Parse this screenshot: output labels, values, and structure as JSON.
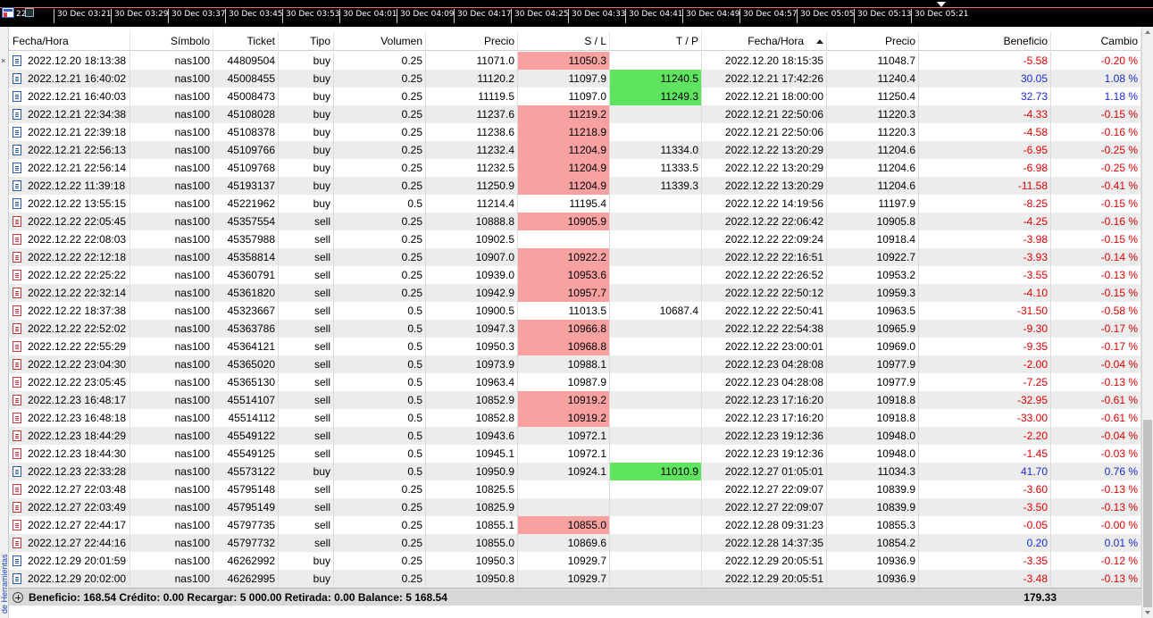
{
  "timeline": {
    "first_label": "22",
    "ticks": [
      "30 Dec 03:21",
      "30 Dec 03:29",
      "30 Dec 03:37",
      "30 Dec 03:45",
      "30 Dec 03:53",
      "30 Dec 04:01",
      "30 Dec 04:09",
      "30 Dec 04:17",
      "30 Dec 04:25",
      "30 Dec 04:33",
      "30 Dec 04:41",
      "30 Dec 04:49",
      "30 Dec 04:57",
      "30 Dec 05:05",
      "30 Dec 05:13",
      "30 Dec 05:21"
    ]
  },
  "sidebar": {
    "label": "de Herramientas",
    "close_glyph": "×"
  },
  "columns": {
    "open_time": "Fecha/Hora",
    "symbol": "Símbolo",
    "ticket": "Ticket",
    "type": "Tipo",
    "volume": "Volumen",
    "open_price": "Precio",
    "sl": "S / L",
    "tp": "T / P",
    "close_time": "Fecha/Hora",
    "close_price": "Precio",
    "profit": "Beneficio",
    "change": "Cambio"
  },
  "rows": [
    {
      "open_time": "2022.12.20 18:13:38",
      "symbol": "nas100",
      "ticket": "44809504",
      "type": "buy",
      "volume": "0.25",
      "open_price": "11071.0",
      "sl": "11050.3",
      "sl_hit": true,
      "tp": "",
      "tp_hit": false,
      "close_time": "2022.12.20 18:15:35",
      "close_price": "11048.7",
      "profit": "-5.58",
      "change": "-0.20 %"
    },
    {
      "open_time": "2022.12.21 16:40:02",
      "symbol": "nas100",
      "ticket": "45008455",
      "type": "buy",
      "volume": "0.25",
      "open_price": "11120.2",
      "sl": "11097.9",
      "sl_hit": false,
      "tp": "11240.5",
      "tp_hit": true,
      "close_time": "2022.12.21 17:42:26",
      "close_price": "11240.4",
      "profit": "30.05",
      "change": "1.08 %"
    },
    {
      "open_time": "2022.12.21 16:40:03",
      "symbol": "nas100",
      "ticket": "45008473",
      "type": "buy",
      "volume": "0.25",
      "open_price": "11119.5",
      "sl": "11097.0",
      "sl_hit": false,
      "tp": "11249.3",
      "tp_hit": true,
      "close_time": "2022.12.21 18:00:00",
      "close_price": "11250.4",
      "profit": "32.73",
      "change": "1.18 %"
    },
    {
      "open_time": "2022.12.21 22:34:38",
      "symbol": "nas100",
      "ticket": "45108028",
      "type": "buy",
      "volume": "0.25",
      "open_price": "11237.6",
      "sl": "11219.2",
      "sl_hit": true,
      "tp": "",
      "tp_hit": false,
      "close_time": "2022.12.21 22:50:06",
      "close_price": "11220.3",
      "profit": "-4.33",
      "change": "-0.15 %"
    },
    {
      "open_time": "2022.12.21 22:39:18",
      "symbol": "nas100",
      "ticket": "45108378",
      "type": "buy",
      "volume": "0.25",
      "open_price": "11238.6",
      "sl": "11218.9",
      "sl_hit": true,
      "tp": "",
      "tp_hit": false,
      "close_time": "2022.12.21 22:50:06",
      "close_price": "11220.3",
      "profit": "-4.58",
      "change": "-0.16 %"
    },
    {
      "open_time": "2022.12.21 22:56:13",
      "symbol": "nas100",
      "ticket": "45109766",
      "type": "buy",
      "volume": "0.25",
      "open_price": "11232.4",
      "sl": "11204.9",
      "sl_hit": true,
      "tp": "11334.0",
      "tp_hit": false,
      "close_time": "2022.12.22 13:20:29",
      "close_price": "11204.6",
      "profit": "-6.95",
      "change": "-0.25 %"
    },
    {
      "open_time": "2022.12.21 22:56:14",
      "symbol": "nas100",
      "ticket": "45109768",
      "type": "buy",
      "volume": "0.25",
      "open_price": "11232.5",
      "sl": "11204.9",
      "sl_hit": true,
      "tp": "11333.5",
      "tp_hit": false,
      "close_time": "2022.12.22 13:20:29",
      "close_price": "11204.6",
      "profit": "-6.98",
      "change": "-0.25 %"
    },
    {
      "open_time": "2022.12.22 11:39:18",
      "symbol": "nas100",
      "ticket": "45193137",
      "type": "buy",
      "volume": "0.25",
      "open_price": "11250.9",
      "sl": "11204.9",
      "sl_hit": true,
      "tp": "11339.3",
      "tp_hit": false,
      "close_time": "2022.12.22 13:20:29",
      "close_price": "11204.6",
      "profit": "-11.58",
      "change": "-0.41 %"
    },
    {
      "open_time": "2022.12.22 13:55:15",
      "symbol": "nas100",
      "ticket": "45221962",
      "type": "buy",
      "volume": "0.5",
      "open_price": "11214.4",
      "sl": "11195.4",
      "sl_hit": false,
      "tp": "",
      "tp_hit": false,
      "close_time": "2022.12.22 14:19:56",
      "close_price": "11197.9",
      "profit": "-8.25",
      "change": "-0.15 %"
    },
    {
      "open_time": "2022.12.22 22:05:45",
      "symbol": "nas100",
      "ticket": "45357554",
      "type": "sell",
      "volume": "0.25",
      "open_price": "10888.8",
      "sl": "10905.9",
      "sl_hit": true,
      "tp": "",
      "tp_hit": false,
      "close_time": "2022.12.22 22:06:42",
      "close_price": "10905.8",
      "profit": "-4.25",
      "change": "-0.16 %"
    },
    {
      "open_time": "2022.12.22 22:08:03",
      "symbol": "nas100",
      "ticket": "45357988",
      "type": "sell",
      "volume": "0.25",
      "open_price": "10902.5",
      "sl": "",
      "sl_hit": false,
      "tp": "",
      "tp_hit": false,
      "close_time": "2022.12.22 22:09:24",
      "close_price": "10918.4",
      "profit": "-3.98",
      "change": "-0.15 %"
    },
    {
      "open_time": "2022.12.22 22:12:18",
      "symbol": "nas100",
      "ticket": "45358814",
      "type": "sell",
      "volume": "0.25",
      "open_price": "10907.0",
      "sl": "10922.2",
      "sl_hit": true,
      "tp": "",
      "tp_hit": false,
      "close_time": "2022.12.22 22:16:51",
      "close_price": "10922.7",
      "profit": "-3.93",
      "change": "-0.14 %"
    },
    {
      "open_time": "2022.12.22 22:25:22",
      "symbol": "nas100",
      "ticket": "45360791",
      "type": "sell",
      "volume": "0.25",
      "open_price": "10939.0",
      "sl": "10953.6",
      "sl_hit": true,
      "tp": "",
      "tp_hit": false,
      "close_time": "2022.12.22 22:26:52",
      "close_price": "10953.2",
      "profit": "-3.55",
      "change": "-0.13 %"
    },
    {
      "open_time": "2022.12.22 22:32:14",
      "symbol": "nas100",
      "ticket": "45361820",
      "type": "sell",
      "volume": "0.25",
      "open_price": "10942.9",
      "sl": "10957.7",
      "sl_hit": true,
      "tp": "",
      "tp_hit": false,
      "close_time": "2022.12.22 22:50:12",
      "close_price": "10959.3",
      "profit": "-4.10",
      "change": "-0.15 %"
    },
    {
      "open_time": "2022.12.22 18:37:38",
      "symbol": "nas100",
      "ticket": "45323667",
      "type": "sell",
      "volume": "0.5",
      "open_price": "10900.5",
      "sl": "11013.5",
      "sl_hit": false,
      "tp": "10687.4",
      "tp_hit": false,
      "close_time": "2022.12.22 22:50:41",
      "close_price": "10963.5",
      "profit": "-31.50",
      "change": "-0.58 %"
    },
    {
      "open_time": "2022.12.22 22:52:02",
      "symbol": "nas100",
      "ticket": "45363786",
      "type": "sell",
      "volume": "0.5",
      "open_price": "10947.3",
      "sl": "10966.8",
      "sl_hit": true,
      "tp": "",
      "tp_hit": false,
      "close_time": "2022.12.22 22:54:38",
      "close_price": "10965.9",
      "profit": "-9.30",
      "change": "-0.17 %"
    },
    {
      "open_time": "2022.12.22 22:55:29",
      "symbol": "nas100",
      "ticket": "45364121",
      "type": "sell",
      "volume": "0.5",
      "open_price": "10950.3",
      "sl": "10968.8",
      "sl_hit": true,
      "tp": "",
      "tp_hit": false,
      "close_time": "2022.12.22 23:00:01",
      "close_price": "10969.0",
      "profit": "-9.35",
      "change": "-0.17 %"
    },
    {
      "open_time": "2022.12.22 23:04:30",
      "symbol": "nas100",
      "ticket": "45365020",
      "type": "sell",
      "volume": "0.5",
      "open_price": "10973.9",
      "sl": "10988.1",
      "sl_hit": false,
      "tp": "",
      "tp_hit": false,
      "close_time": "2022.12.23 04:28:08",
      "close_price": "10977.9",
      "profit": "-2.00",
      "change": "-0.04 %"
    },
    {
      "open_time": "2022.12.22 23:05:45",
      "symbol": "nas100",
      "ticket": "45365130",
      "type": "sell",
      "volume": "0.5",
      "open_price": "10963.4",
      "sl": "10987.9",
      "sl_hit": false,
      "tp": "",
      "tp_hit": false,
      "close_time": "2022.12.23 04:28:08",
      "close_price": "10977.9",
      "profit": "-7.25",
      "change": "-0.13 %"
    },
    {
      "open_time": "2022.12.23 16:48:17",
      "symbol": "nas100",
      "ticket": "45514107",
      "type": "sell",
      "volume": "0.5",
      "open_price": "10852.9",
      "sl": "10919.2",
      "sl_hit": true,
      "tp": "",
      "tp_hit": false,
      "close_time": "2022.12.23 17:16:20",
      "close_price": "10918.8",
      "profit": "-32.95",
      "change": "-0.61 %"
    },
    {
      "open_time": "2022.12.23 16:48:18",
      "symbol": "nas100",
      "ticket": "45514112",
      "type": "sell",
      "volume": "0.5",
      "open_price": "10852.8",
      "sl": "10919.2",
      "sl_hit": true,
      "tp": "",
      "tp_hit": false,
      "close_time": "2022.12.23 17:16:20",
      "close_price": "10918.8",
      "profit": "-33.00",
      "change": "-0.61 %"
    },
    {
      "open_time": "2022.12.23 18:44:29",
      "symbol": "nas100",
      "ticket": "45549122",
      "type": "sell",
      "volume": "0.5",
      "open_price": "10943.6",
      "sl": "10972.1",
      "sl_hit": false,
      "tp": "",
      "tp_hit": false,
      "close_time": "2022.12.23 19:12:36",
      "close_price": "10948.0",
      "profit": "-2.20",
      "change": "-0.04 %"
    },
    {
      "open_time": "2022.12.23 18:44:30",
      "symbol": "nas100",
      "ticket": "45549125",
      "type": "sell",
      "volume": "0.5",
      "open_price": "10945.1",
      "sl": "10972.1",
      "sl_hit": false,
      "tp": "",
      "tp_hit": false,
      "close_time": "2022.12.23 19:12:36",
      "close_price": "10948.0",
      "profit": "-1.45",
      "change": "-0.03 %"
    },
    {
      "open_time": "2022.12.23 22:33:28",
      "symbol": "nas100",
      "ticket": "45573122",
      "type": "buy",
      "volume": "0.5",
      "open_price": "10950.9",
      "sl": "10924.1",
      "sl_hit": false,
      "tp": "11010.9",
      "tp_hit": true,
      "close_time": "2022.12.27 01:05:01",
      "close_price": "11034.3",
      "profit": "41.70",
      "change": "0.76 %"
    },
    {
      "open_time": "2022.12.27 22:03:48",
      "symbol": "nas100",
      "ticket": "45795148",
      "type": "sell",
      "volume": "0.25",
      "open_price": "10825.5",
      "sl": "",
      "sl_hit": false,
      "tp": "",
      "tp_hit": false,
      "close_time": "2022.12.27 22:09:07",
      "close_price": "10839.9",
      "profit": "-3.60",
      "change": "-0.13 %"
    },
    {
      "open_time": "2022.12.27 22:03:49",
      "symbol": "nas100",
      "ticket": "45795149",
      "type": "sell",
      "volume": "0.25",
      "open_price": "10825.9",
      "sl": "",
      "sl_hit": false,
      "tp": "",
      "tp_hit": false,
      "close_time": "2022.12.27 22:09:07",
      "close_price": "10839.9",
      "profit": "-3.50",
      "change": "-0.13 %"
    },
    {
      "open_time": "2022.12.27 22:44:17",
      "symbol": "nas100",
      "ticket": "45797735",
      "type": "sell",
      "volume": "0.25",
      "open_price": "10855.1",
      "sl": "10855.0",
      "sl_hit": true,
      "tp": "",
      "tp_hit": false,
      "close_time": "2022.12.28 09:31:23",
      "close_price": "10855.3",
      "profit": "-0.05",
      "change": "-0.00 %"
    },
    {
      "open_time": "2022.12.27 22:44:16",
      "symbol": "nas100",
      "ticket": "45797732",
      "type": "sell",
      "volume": "0.25",
      "open_price": "10855.0",
      "sl": "10869.6",
      "sl_hit": false,
      "tp": "",
      "tp_hit": false,
      "close_time": "2022.12.28 14:37:35",
      "close_price": "10854.2",
      "profit": "0.20",
      "change": "0.01 %"
    },
    {
      "open_time": "2022.12.29 20:01:59",
      "symbol": "nas100",
      "ticket": "46262992",
      "type": "buy",
      "volume": "0.25",
      "open_price": "10950.3",
      "sl": "10929.7",
      "sl_hit": false,
      "tp": "",
      "tp_hit": false,
      "close_time": "2022.12.29 20:05:51",
      "close_price": "10936.9",
      "profit": "-3.35",
      "change": "-0.12 %"
    },
    {
      "open_time": "2022.12.29 20:02:00",
      "symbol": "nas100",
      "ticket": "46262995",
      "type": "buy",
      "volume": "0.25",
      "open_price": "10950.8",
      "sl": "10929.7",
      "sl_hit": false,
      "tp": "",
      "tp_hit": false,
      "close_time": "2022.12.29 20:05:51",
      "close_price": "10936.9",
      "profit": "-3.48",
      "change": "-0.13 %"
    }
  ],
  "footer": {
    "summary": "Beneficio: 168.54  Crédito: 0.00  Recargar: 5 000.00  Retirada: 0.00  Balance: 5 168.54",
    "total": "179.33"
  },
  "colors": {
    "sl_highlight": "#f7a1a1",
    "tp_highlight": "#5ee45e",
    "negative": "#e00000",
    "positive": "#1a2bd8",
    "alt_row": "#ececec"
  }
}
